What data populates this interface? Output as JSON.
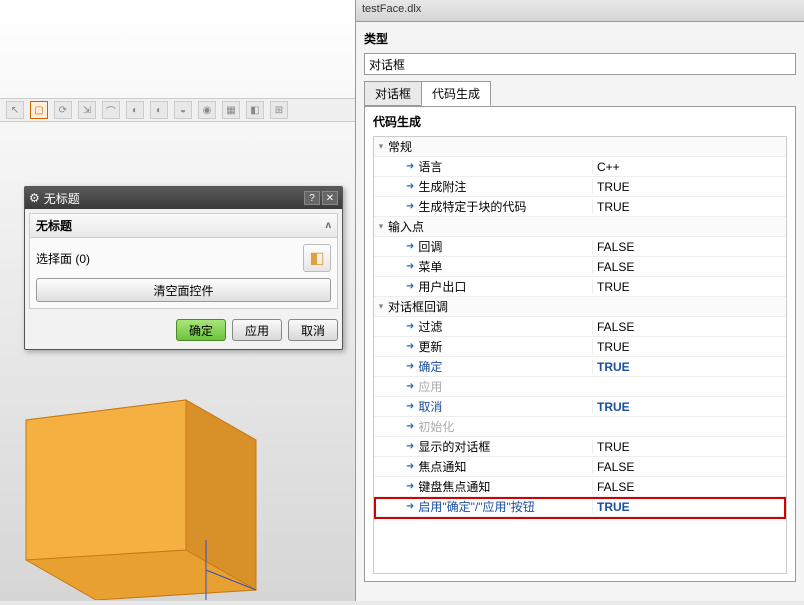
{
  "viewport": {
    "toolbar_icons": [
      "↖",
      "▢",
      "⟳",
      "⇲",
      "⌒",
      "◐",
      "◐",
      "◒",
      "◉",
      "▦",
      "◧",
      "⊞"
    ]
  },
  "dialog": {
    "title": "无标题",
    "section_title": "无标题",
    "face_label": "选择面 (0)",
    "clear_btn": "清空面控件",
    "ok": "确定",
    "apply": "应用",
    "cancel": "取消"
  },
  "right": {
    "file_tab": "testFace.dlx",
    "type_label": "类型",
    "type_value": "对话框",
    "tabs": [
      "对话框",
      "代码生成"
    ],
    "active_tab": 1,
    "panel_label": "代码生成",
    "groups": [
      {
        "name": "常规",
        "items": [
          {
            "key": "语言",
            "val": "C++",
            "keyStyle": "",
            "valStyle": ""
          },
          {
            "key": "生成附注",
            "val": "TRUE",
            "keyStyle": "",
            "valStyle": ""
          },
          {
            "key": "生成特定于块的代码",
            "val": "TRUE",
            "keyStyle": "",
            "valStyle": ""
          }
        ]
      },
      {
        "name": "输入点",
        "items": [
          {
            "key": "回调",
            "val": "FALSE",
            "keyStyle": "",
            "valStyle": ""
          },
          {
            "key": "菜单",
            "val": "FALSE",
            "keyStyle": "",
            "valStyle": ""
          },
          {
            "key": "用户出口",
            "val": "TRUE",
            "keyStyle": "",
            "valStyle": ""
          }
        ]
      },
      {
        "name": "对话框回调",
        "items": [
          {
            "key": "过滤",
            "val": "FALSE",
            "keyStyle": "",
            "valStyle": ""
          },
          {
            "key": "更新",
            "val": "TRUE",
            "keyStyle": "",
            "valStyle": ""
          },
          {
            "key": "确定",
            "val": "TRUE",
            "keyStyle": "blue",
            "valStyle": "blue"
          },
          {
            "key": "应用",
            "val": "",
            "keyStyle": "gray",
            "valStyle": ""
          },
          {
            "key": "取消",
            "val": "TRUE",
            "keyStyle": "blue",
            "valStyle": "blue"
          },
          {
            "key": "初始化",
            "val": "",
            "keyStyle": "gray",
            "valStyle": ""
          },
          {
            "key": "显示的对话框",
            "val": "TRUE",
            "keyStyle": "",
            "valStyle": ""
          },
          {
            "key": "焦点通知",
            "val": "FALSE",
            "keyStyle": "",
            "valStyle": ""
          },
          {
            "key": "键盘焦点通知",
            "val": "FALSE",
            "keyStyle": "",
            "valStyle": ""
          },
          {
            "key": "启用\"确定\"/\"应用\"按钮",
            "val": "TRUE",
            "keyStyle": "blue",
            "valStyle": "blue",
            "highlight": true
          }
        ]
      }
    ]
  }
}
